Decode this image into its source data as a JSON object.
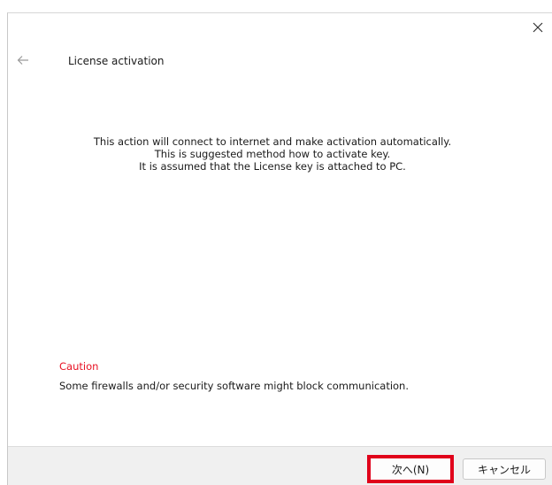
{
  "window": {
    "title": "License activation"
  },
  "message": {
    "lines": [
      "This action will connect to internet and make activation automatically.",
      "This is suggested method how to activate key.",
      "It is assumed that the License key is attached to PC."
    ]
  },
  "caution": {
    "title": "Caution",
    "text": "Some firewalls and/or security software might block communication."
  },
  "footer": {
    "next_label": "次へ(N)",
    "cancel_label": "キャンセル"
  },
  "colors": {
    "caution": "#e81123",
    "highlight": "#e0001a"
  },
  "icons": {
    "close": "close-icon",
    "back": "back-arrow-icon"
  }
}
